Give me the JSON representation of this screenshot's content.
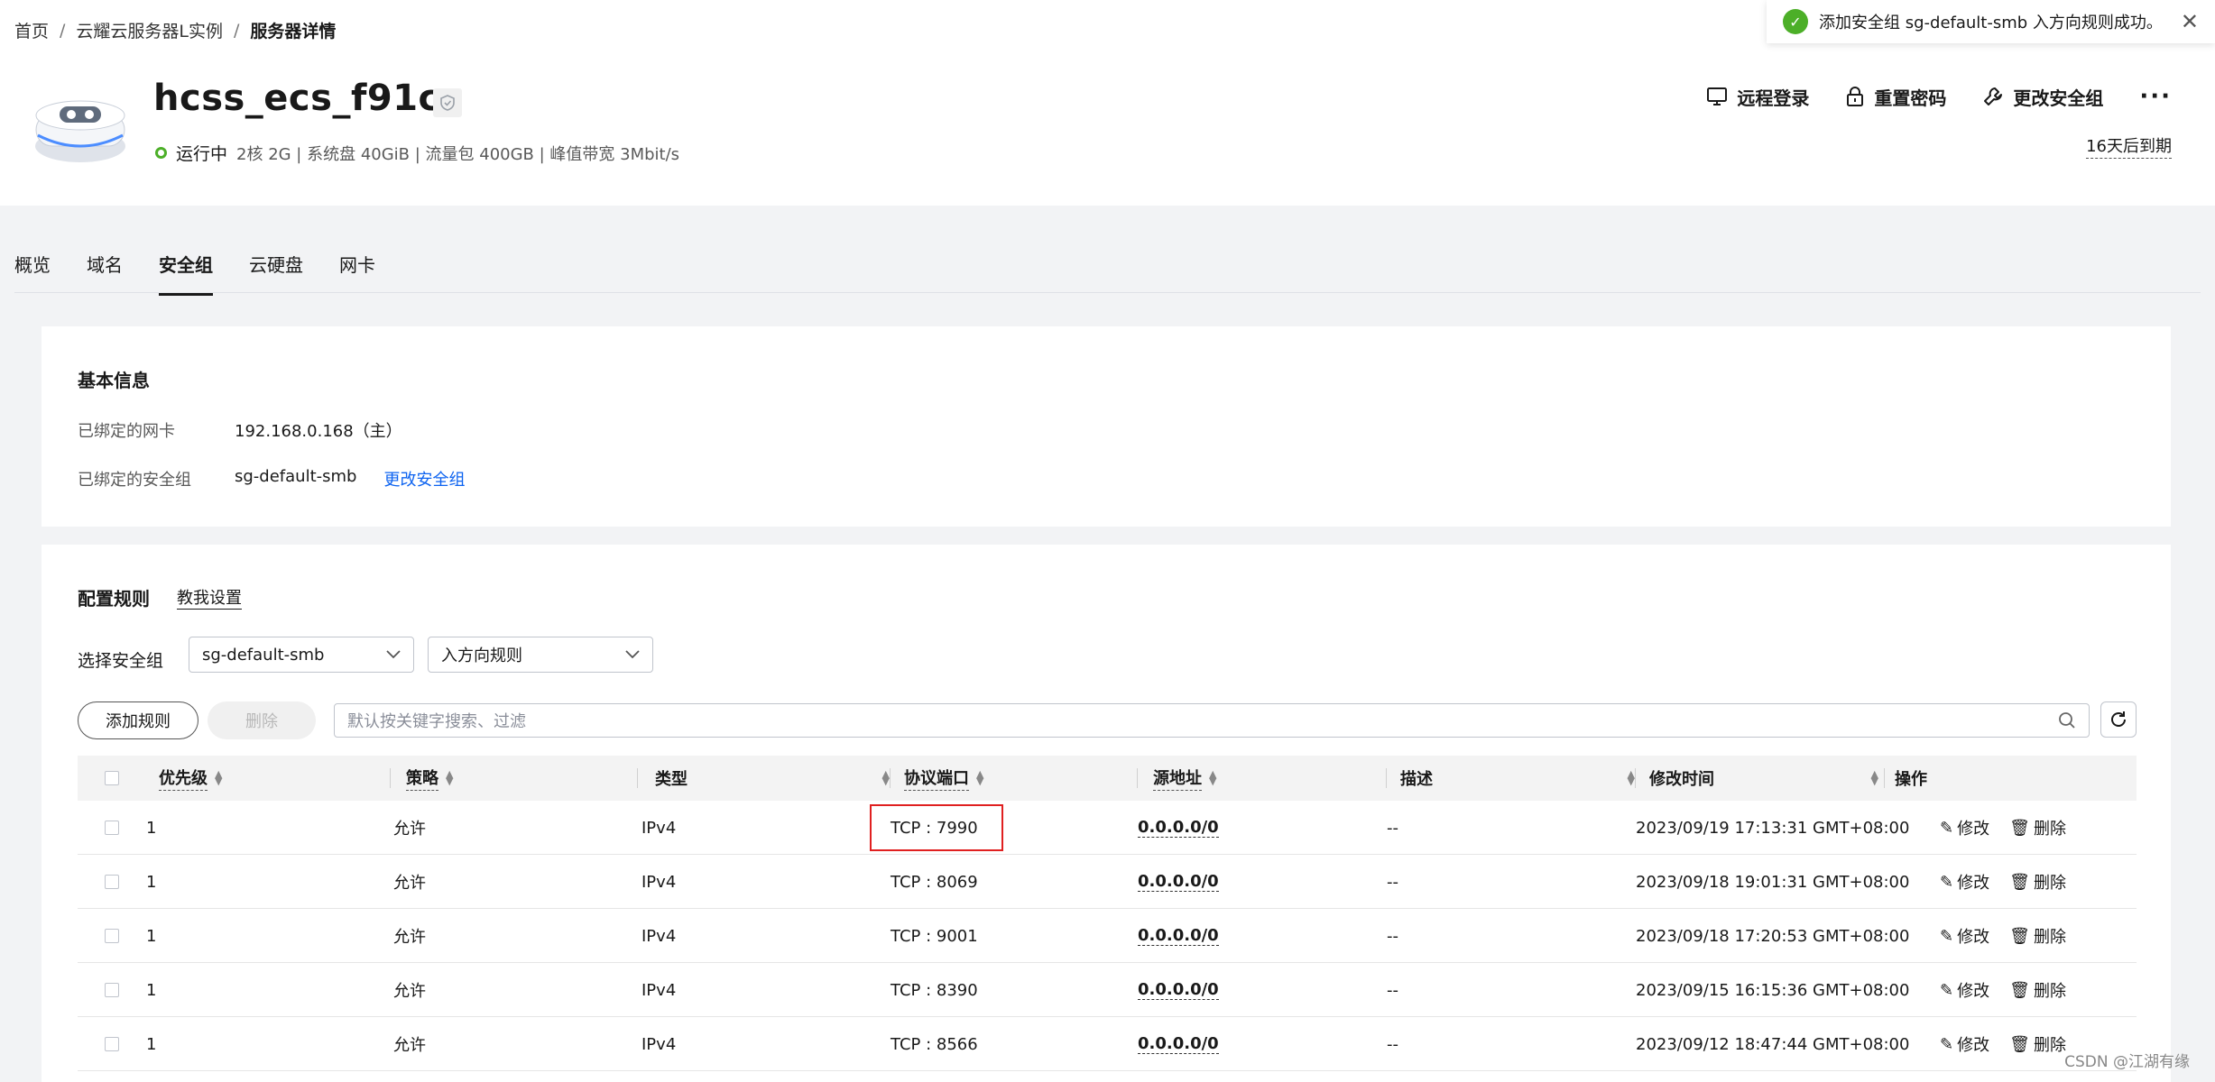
{
  "breadcrumb": {
    "home": "首页",
    "parent": "云耀云服务器L实例",
    "current": "服务器详情",
    "separator": "/"
  },
  "server": {
    "name": "hcss_ecs_f91c",
    "status": "运行中",
    "specs": "2核  2G | 系统盘 40GiB | 流量包 400GB | 峰值带宽 3Mbit/s",
    "expire": "16天后到期"
  },
  "actions": {
    "remote_login": "远程登录",
    "reset_password": "重置密码",
    "change_sg": "更改安全组",
    "more": "···"
  },
  "tabs": [
    "概览",
    "域名",
    "安全组",
    "云硬盘",
    "网卡"
  ],
  "basic_info": {
    "title": "基本信息",
    "nic_label": "已绑定的网卡",
    "nic_value": "192.168.0.168（主）",
    "sg_label": "已绑定的安全组",
    "sg_value": "sg-default-smb",
    "change_link": "更改安全组"
  },
  "rules": {
    "title": "配置规则",
    "teach_link": "教我设置",
    "select_label": "选择安全组",
    "sg_select": "sg-default-smb",
    "direction_select": "入方向规则",
    "add_button": "添加规则",
    "delete_button": "删除",
    "search_placeholder": "默认按关键字搜索、过滤",
    "columns": {
      "priority": "优先级",
      "policy": "策略",
      "type": "类型",
      "port": "协议端口",
      "source": "源地址",
      "desc": "描述",
      "modified": "修改时间",
      "ops": "操作"
    },
    "op_edit": "修改",
    "op_delete": "删除",
    "rows": [
      {
        "priority": "1",
        "policy": "允许",
        "type": "IPv4",
        "port": "TCP : 7990",
        "source": "0.0.0.0/0",
        "desc": "--",
        "modified": "2023/09/19 17:13:31 GMT+08:00"
      },
      {
        "priority": "1",
        "policy": "允许",
        "type": "IPv4",
        "port": "TCP : 8069",
        "source": "0.0.0.0/0",
        "desc": "--",
        "modified": "2023/09/18 19:01:31 GMT+08:00"
      },
      {
        "priority": "1",
        "policy": "允许",
        "type": "IPv4",
        "port": "TCP : 9001",
        "source": "0.0.0.0/0",
        "desc": "--",
        "modified": "2023/09/18 17:20:53 GMT+08:00"
      },
      {
        "priority": "1",
        "policy": "允许",
        "type": "IPv4",
        "port": "TCP : 8390",
        "source": "0.0.0.0/0",
        "desc": "--",
        "modified": "2023/09/15 16:15:36 GMT+08:00"
      },
      {
        "priority": "1",
        "policy": "允许",
        "type": "IPv4",
        "port": "TCP : 8566",
        "source": "0.0.0.0/0",
        "desc": "--",
        "modified": "2023/09/12 18:47:44 GMT+08:00"
      }
    ]
  },
  "toast": {
    "message": "添加安全组 sg-default-smb 入方向规则成功。"
  },
  "watermark": "CSDN @江湖有缘",
  "colors": {
    "accent_link": "#0d63f0",
    "status_green": "#4caf28",
    "highlight_red": "#e02020"
  }
}
